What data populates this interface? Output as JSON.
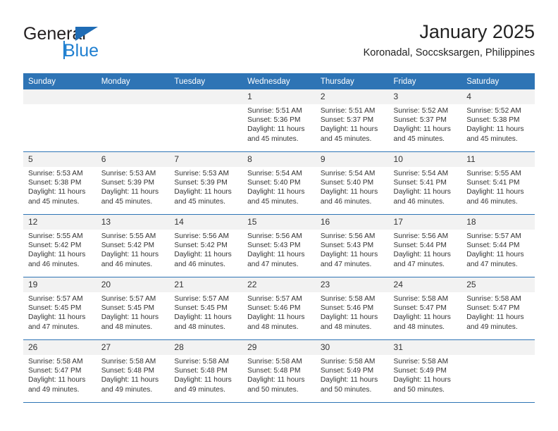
{
  "brand": {
    "line1": "General",
    "line2": "Blue",
    "accent_color": "#1f7fd0",
    "triangle_color": "#1f6cb5"
  },
  "header": {
    "title": "January 2025",
    "subtitle": "Koronadal, Soccsksargen, Philippines"
  },
  "calendar": {
    "header_color": "#2e74b5",
    "daynum_band_color": "#f2f2f2",
    "weekdays": [
      "Sunday",
      "Monday",
      "Tuesday",
      "Wednesday",
      "Thursday",
      "Friday",
      "Saturday"
    ],
    "weeks": [
      [
        {
          "day": "",
          "sunrise": "",
          "sunset": "",
          "daylight": ""
        },
        {
          "day": "",
          "sunrise": "",
          "sunset": "",
          "daylight": ""
        },
        {
          "day": "",
          "sunrise": "",
          "sunset": "",
          "daylight": ""
        },
        {
          "day": "1",
          "sunrise": "Sunrise: 5:51 AM",
          "sunset": "Sunset: 5:36 PM",
          "daylight": "Daylight: 11 hours and 45 minutes."
        },
        {
          "day": "2",
          "sunrise": "Sunrise: 5:51 AM",
          "sunset": "Sunset: 5:37 PM",
          "daylight": "Daylight: 11 hours and 45 minutes."
        },
        {
          "day": "3",
          "sunrise": "Sunrise: 5:52 AM",
          "sunset": "Sunset: 5:37 PM",
          "daylight": "Daylight: 11 hours and 45 minutes."
        },
        {
          "day": "4",
          "sunrise": "Sunrise: 5:52 AM",
          "sunset": "Sunset: 5:38 PM",
          "daylight": "Daylight: 11 hours and 45 minutes."
        }
      ],
      [
        {
          "day": "5",
          "sunrise": "Sunrise: 5:53 AM",
          "sunset": "Sunset: 5:38 PM",
          "daylight": "Daylight: 11 hours and 45 minutes."
        },
        {
          "day": "6",
          "sunrise": "Sunrise: 5:53 AM",
          "sunset": "Sunset: 5:39 PM",
          "daylight": "Daylight: 11 hours and 45 minutes."
        },
        {
          "day": "7",
          "sunrise": "Sunrise: 5:53 AM",
          "sunset": "Sunset: 5:39 PM",
          "daylight": "Daylight: 11 hours and 45 minutes."
        },
        {
          "day": "8",
          "sunrise": "Sunrise: 5:54 AM",
          "sunset": "Sunset: 5:40 PM",
          "daylight": "Daylight: 11 hours and 45 minutes."
        },
        {
          "day": "9",
          "sunrise": "Sunrise: 5:54 AM",
          "sunset": "Sunset: 5:40 PM",
          "daylight": "Daylight: 11 hours and 46 minutes."
        },
        {
          "day": "10",
          "sunrise": "Sunrise: 5:54 AM",
          "sunset": "Sunset: 5:41 PM",
          "daylight": "Daylight: 11 hours and 46 minutes."
        },
        {
          "day": "11",
          "sunrise": "Sunrise: 5:55 AM",
          "sunset": "Sunset: 5:41 PM",
          "daylight": "Daylight: 11 hours and 46 minutes."
        }
      ],
      [
        {
          "day": "12",
          "sunrise": "Sunrise: 5:55 AM",
          "sunset": "Sunset: 5:42 PM",
          "daylight": "Daylight: 11 hours and 46 minutes."
        },
        {
          "day": "13",
          "sunrise": "Sunrise: 5:55 AM",
          "sunset": "Sunset: 5:42 PM",
          "daylight": "Daylight: 11 hours and 46 minutes."
        },
        {
          "day": "14",
          "sunrise": "Sunrise: 5:56 AM",
          "sunset": "Sunset: 5:42 PM",
          "daylight": "Daylight: 11 hours and 46 minutes."
        },
        {
          "day": "15",
          "sunrise": "Sunrise: 5:56 AM",
          "sunset": "Sunset: 5:43 PM",
          "daylight": "Daylight: 11 hours and 47 minutes."
        },
        {
          "day": "16",
          "sunrise": "Sunrise: 5:56 AM",
          "sunset": "Sunset: 5:43 PM",
          "daylight": "Daylight: 11 hours and 47 minutes."
        },
        {
          "day": "17",
          "sunrise": "Sunrise: 5:56 AM",
          "sunset": "Sunset: 5:44 PM",
          "daylight": "Daylight: 11 hours and 47 minutes."
        },
        {
          "day": "18",
          "sunrise": "Sunrise: 5:57 AM",
          "sunset": "Sunset: 5:44 PM",
          "daylight": "Daylight: 11 hours and 47 minutes."
        }
      ],
      [
        {
          "day": "19",
          "sunrise": "Sunrise: 5:57 AM",
          "sunset": "Sunset: 5:45 PM",
          "daylight": "Daylight: 11 hours and 47 minutes."
        },
        {
          "day": "20",
          "sunrise": "Sunrise: 5:57 AM",
          "sunset": "Sunset: 5:45 PM",
          "daylight": "Daylight: 11 hours and 48 minutes."
        },
        {
          "day": "21",
          "sunrise": "Sunrise: 5:57 AM",
          "sunset": "Sunset: 5:45 PM",
          "daylight": "Daylight: 11 hours and 48 minutes."
        },
        {
          "day": "22",
          "sunrise": "Sunrise: 5:57 AM",
          "sunset": "Sunset: 5:46 PM",
          "daylight": "Daylight: 11 hours and 48 minutes."
        },
        {
          "day": "23",
          "sunrise": "Sunrise: 5:58 AM",
          "sunset": "Sunset: 5:46 PM",
          "daylight": "Daylight: 11 hours and 48 minutes."
        },
        {
          "day": "24",
          "sunrise": "Sunrise: 5:58 AM",
          "sunset": "Sunset: 5:47 PM",
          "daylight": "Daylight: 11 hours and 48 minutes."
        },
        {
          "day": "25",
          "sunrise": "Sunrise: 5:58 AM",
          "sunset": "Sunset: 5:47 PM",
          "daylight": "Daylight: 11 hours and 49 minutes."
        }
      ],
      [
        {
          "day": "26",
          "sunrise": "Sunrise: 5:58 AM",
          "sunset": "Sunset: 5:47 PM",
          "daylight": "Daylight: 11 hours and 49 minutes."
        },
        {
          "day": "27",
          "sunrise": "Sunrise: 5:58 AM",
          "sunset": "Sunset: 5:48 PM",
          "daylight": "Daylight: 11 hours and 49 minutes."
        },
        {
          "day": "28",
          "sunrise": "Sunrise: 5:58 AM",
          "sunset": "Sunset: 5:48 PM",
          "daylight": "Daylight: 11 hours and 49 minutes."
        },
        {
          "day": "29",
          "sunrise": "Sunrise: 5:58 AM",
          "sunset": "Sunset: 5:48 PM",
          "daylight": "Daylight: 11 hours and 50 minutes."
        },
        {
          "day": "30",
          "sunrise": "Sunrise: 5:58 AM",
          "sunset": "Sunset: 5:49 PM",
          "daylight": "Daylight: 11 hours and 50 minutes."
        },
        {
          "day": "31",
          "sunrise": "Sunrise: 5:58 AM",
          "sunset": "Sunset: 5:49 PM",
          "daylight": "Daylight: 11 hours and 50 minutes."
        },
        {
          "day": "",
          "sunrise": "",
          "sunset": "",
          "daylight": ""
        }
      ]
    ]
  }
}
